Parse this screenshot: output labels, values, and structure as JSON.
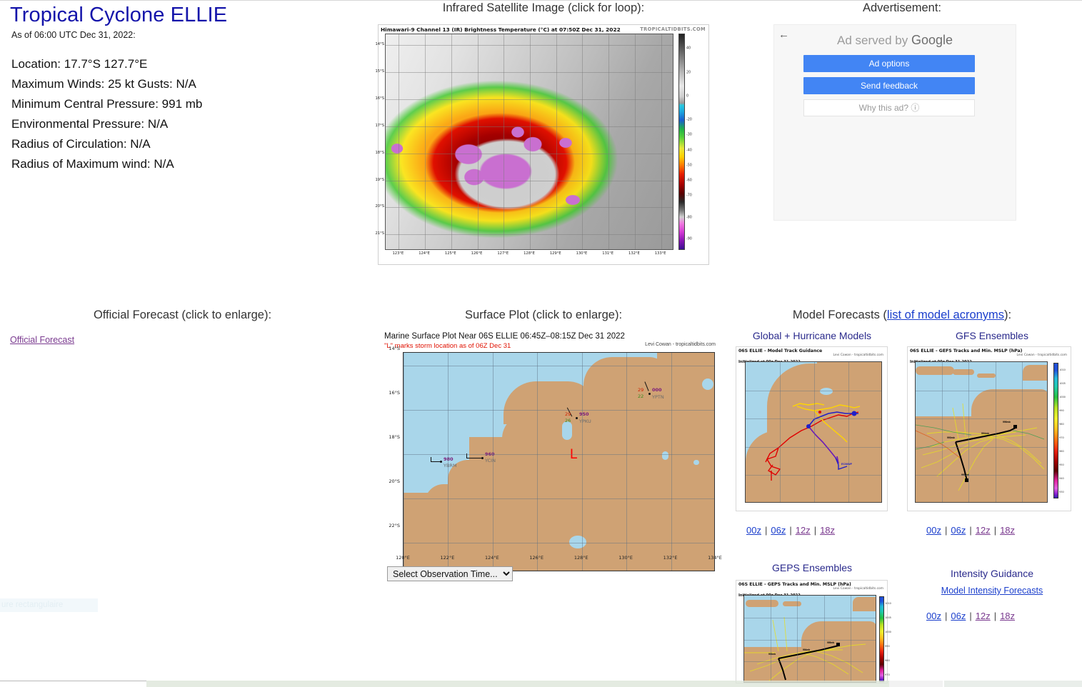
{
  "storm": {
    "title": "Tropical Cyclone ELLIE",
    "as_of": "As of 06:00 UTC Dec 31, 2022:",
    "location": "Location: 17.7°S 127.7°E",
    "winds": "Maximum Winds: 25 kt  Gusts: N/A",
    "pressure": "Minimum Central Pressure: 991 mb",
    "env_pressure": "Environmental Pressure: N/A",
    "radius_circ": "Radius of Circulation: N/A",
    "radius_max_wind": "Radius of Maximum wind: N/A"
  },
  "satellite": {
    "caption": "Infrared Satellite Image (click for loop):",
    "header": "Himawari-9 Channel 13 (IR) Brightness Temperature (°C) at 07:50Z Dec 31, 2022",
    "watermark": "TROPICALTIDBITS.COM",
    "xticks": [
      "123°E",
      "124°E",
      "125°E",
      "126°E",
      "127°E",
      "128°E",
      "129°E",
      "130°E",
      "131°E",
      "132°E",
      "133°E"
    ],
    "yticks": [
      "14°S",
      "15°S",
      "16°S",
      "17°S",
      "18°S",
      "19°S",
      "20°S",
      "21°S"
    ],
    "colorbar_ticks": [
      "40",
      "20",
      "0",
      "-20",
      "-30",
      "-40",
      "-50",
      "-60",
      "-70",
      "-80",
      "-90"
    ]
  },
  "ad": {
    "caption": "Advertisement:",
    "back_icon": "back-arrow-icon",
    "served_prefix": "Ad served by ",
    "served_brand": "Google",
    "options_label": "Ad options",
    "feedback_label": "Send feedback",
    "why_label": "Why this ad? ⓘ",
    "button_color": "#4285f4"
  },
  "official": {
    "caption": "Official Forecast (click to enlarge):",
    "link_label": "Official Forecast"
  },
  "surface": {
    "caption": "Surface Plot (click to enlarge):",
    "title": "Marine Surface Plot Near 06S ELLIE 06:45Z–08:15Z Dec 31 2022",
    "subtitle": "\"L\" marks storm location as of 06Z Dec 31",
    "attribution": "Levi Cowan - tropicaltidbits.com",
    "low_marker": "L",
    "select_value": "Select Observation Time...",
    "xticks": [
      "120°E",
      "122°E",
      "124°E",
      "126°E",
      "128°E",
      "130°E",
      "132°E",
      "134°E"
    ],
    "yticks": [
      "14°S",
      "16°S",
      "18°S",
      "20°S",
      "22°S"
    ],
    "stations": [
      {
        "id": "YBRM",
        "pressure": "980",
        "temp": "",
        "dew": ""
      },
      {
        "id": "YCIN",
        "pressure": "960",
        "temp": "",
        "dew": ""
      },
      {
        "id": "YPKU",
        "pressure": "950",
        "temp": "29",
        "dew": "26"
      },
      {
        "id": "YPTN",
        "pressure": "000",
        "temp": "29",
        "dew": "22"
      }
    ]
  },
  "models": {
    "caption_prefix": "Model Forecasts (",
    "caption_link": "list of model acronyms",
    "caption_suffix": "):",
    "panels": [
      {
        "heading": "Global + Hurricane Models",
        "title": "06S ELLIE - Model Track Guidance",
        "subtitle": "Initialized at 00z Dec 31 2022",
        "attribution": "Levi Cowan - tropicaltidbits.com",
        "links": [
          "00z",
          "06z",
          "12z",
          "18z"
        ],
        "link_states": [
          "u",
          "u",
          "v",
          "v"
        ]
      },
      {
        "heading": "GFS Ensembles",
        "title": "06S ELLIE - GEFS Tracks and Min. MSLP (hPa)",
        "subtitle": "Initialized at 00z Dec 31 2022",
        "attribution": "Levi Cowan - tropicaltidbits.com",
        "links": [
          "00z",
          "06z",
          "12z",
          "18z"
        ],
        "link_states": [
          "u",
          "u",
          "v",
          "v"
        ],
        "colorbar_ticks": [
          "1010",
          "1005",
          "1000",
          "990",
          "980",
          "970",
          "960",
          "950",
          "940",
          "930"
        ]
      },
      {
        "heading": "GEPS Ensembles",
        "title": "06S ELLIE - GEPS Tracks and Min. MSLP (hPa)",
        "subtitle": "Initialized at 00z Dec 31 2022",
        "attribution": "Levi Cowan - tropicaltidbits.com",
        "colorbar_ticks": [
          "1010",
          "1005",
          "1000",
          "990",
          "980",
          "970"
        ]
      },
      {
        "heading": "Intensity Guidance",
        "intensity_link": "Model Intensity Forecasts",
        "links": [
          "00z",
          "06z",
          "12z",
          "18z"
        ],
        "link_states": [
          "u",
          "u",
          "v",
          "v"
        ]
      }
    ]
  },
  "stray": {
    "french_text": "ure rectangulaire"
  }
}
